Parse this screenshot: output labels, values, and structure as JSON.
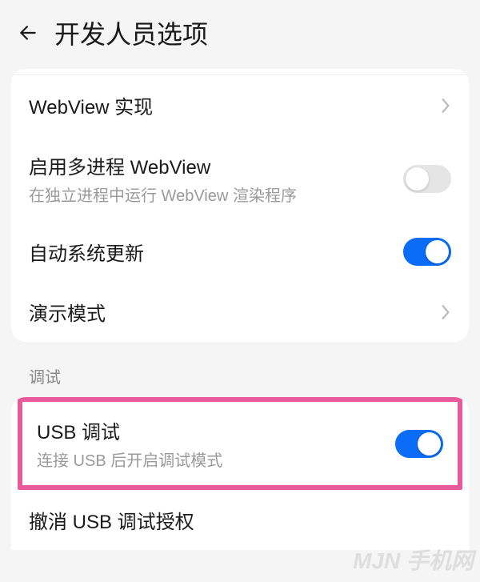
{
  "header": {
    "title": "开发人员选项"
  },
  "section1": {
    "webview": {
      "title": "WebView 实现"
    },
    "multiprocess": {
      "title": "启用多进程 WebView",
      "subtitle": "在独立进程中运行 WebView 渲染程序"
    },
    "autoupdate": {
      "title": "自动系统更新"
    },
    "demomode": {
      "title": "演示模式"
    }
  },
  "section2": {
    "label": "调试",
    "usb_debug": {
      "title": "USB 调试",
      "subtitle": "连接 USB 后开启调试模式"
    },
    "revoke_usb": {
      "title": "撤消 USB 调试授权"
    }
  },
  "toggles": {
    "multiprocess": "off",
    "autoupdate": "on",
    "usb_debug": "on"
  },
  "watermark": "MJN 手机网"
}
